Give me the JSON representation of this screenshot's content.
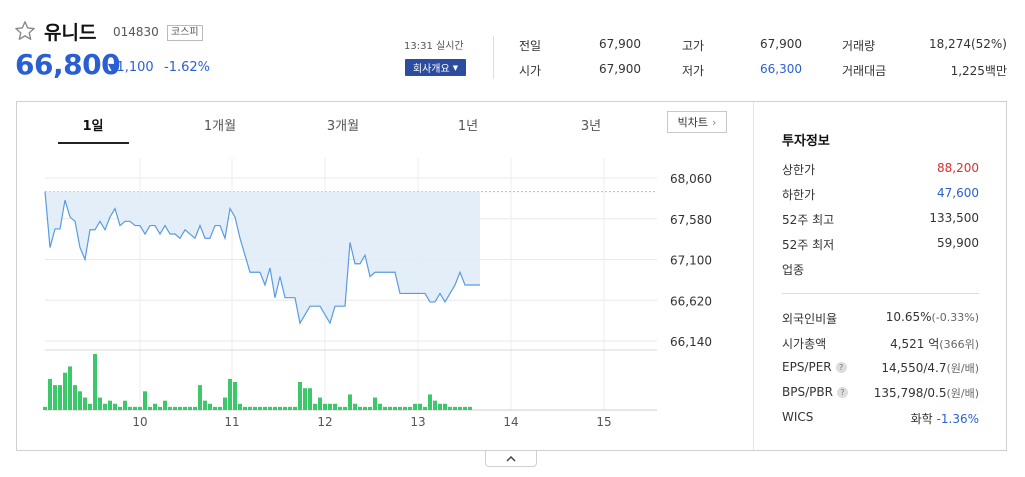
{
  "stock": {
    "name": "유니드",
    "code": "014830",
    "market": "코스피",
    "price": "66,800",
    "change": "1,100",
    "change_pct": "-1.62%",
    "realtime": "13:31 실시간",
    "company_button": "회사개요"
  },
  "summary": [
    {
      "label": "전일",
      "value": "67,900"
    },
    {
      "label": "고가",
      "value": "67,900"
    },
    {
      "label": "거래량",
      "value": "18,274(52%)"
    },
    {
      "label": "시가",
      "value": "67,900"
    },
    {
      "label": "저가",
      "value": "66,300"
    },
    {
      "label": "거래대금",
      "value": "1,225백만"
    }
  ],
  "tabs": [
    "1일",
    "1개월",
    "3개월",
    "1년",
    "3년"
  ],
  "big_chart_label": "빅차트",
  "invest": {
    "title": "투자정보",
    "rows": [
      {
        "label": "상한가",
        "value": "88,200"
      },
      {
        "label": "하한가",
        "value": "47,600"
      },
      {
        "label": "52주 최고",
        "value": "133,500"
      },
      {
        "label": "52주 최저",
        "value": "59,900"
      },
      {
        "label": "업종",
        "value": ""
      },
      {
        "label": "외국인비율",
        "value": "10.65%",
        "sub": "(-0.33%)"
      },
      {
        "label": "시가총액",
        "value": "4,521 억",
        "sub": "(366위)"
      },
      {
        "label": "EPS/PER",
        "value": "14,550/4.7",
        "sub": "(원/배)"
      },
      {
        "label": "BPS/PBR",
        "value": "135,798/0.5",
        "sub": "(원/배)"
      },
      {
        "label": "WICS",
        "value": "화학",
        "sub": "-1.36%"
      }
    ]
  },
  "colors": {
    "down": "#2a5fd4",
    "up": "#d9302c",
    "line": "#5a9be0",
    "fill": "#deebf8",
    "volume": "#3cc76a"
  },
  "chart_data": {
    "type": "line",
    "y_ticks": [
      "68,060",
      "67,580",
      "67,100",
      "66,620",
      "66,140"
    ],
    "ylim": [
      66140,
      68060
    ],
    "x_ticks": [
      "10",
      "11",
      "12",
      "13",
      "14",
      "15"
    ],
    "reference_line": 67900,
    "price_series": [
      67900,
      67240,
      67460,
      67460,
      67800,
      67600,
      67550,
      67240,
      67100,
      67450,
      67450,
      67550,
      67450,
      67600,
      67700,
      67500,
      67550,
      67550,
      67500,
      67500,
      67400,
      67500,
      67500,
      67400,
      67500,
      67400,
      67400,
      67350,
      67450,
      67400,
      67350,
      67500,
      67350,
      67350,
      67500,
      67500,
      67350,
      67700,
      67600,
      67350,
      67150,
      66950,
      66950,
      66950,
      66800,
      67000,
      66650,
      66900,
      66650,
      66650,
      66650,
      66350,
      66450,
      66550,
      66550,
      66550,
      66450,
      66350,
      66550,
      66550,
      66550,
      67300,
      67050,
      67050,
      67150,
      66900,
      66950,
      66950,
      66950,
      66950,
      66950,
      66700,
      66700,
      66700,
      66700,
      66700,
      66700,
      66600,
      66600,
      66700,
      66600,
      66700,
      66800,
      66950,
      66800,
      66800,
      66800,
      66800
    ],
    "volume_series": [
      1,
      10,
      8,
      8,
      12,
      14,
      8,
      6,
      4,
      2,
      18,
      4,
      2,
      3,
      2,
      1,
      3,
      1,
      1,
      1,
      6,
      1,
      2,
      1,
      3,
      1,
      1,
      1,
      1,
      1,
      1,
      8,
      3,
      2,
      1,
      1,
      4,
      10,
      9,
      2,
      1,
      1,
      1,
      1,
      1,
      1,
      1,
      1,
      1,
      1,
      1,
      9,
      7,
      7,
      2,
      4,
      2,
      2,
      2,
      1,
      1,
      5,
      2,
      1,
      1,
      1,
      4,
      2,
      1,
      1,
      1,
      1,
      1,
      1,
      2,
      2,
      1,
      5,
      3,
      2,
      2,
      1,
      1,
      1,
      1,
      1
    ]
  }
}
